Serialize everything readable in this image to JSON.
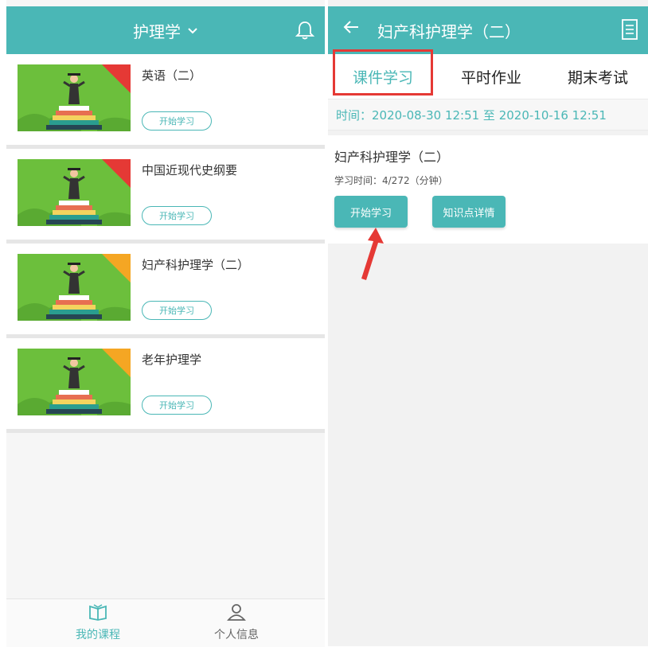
{
  "left": {
    "header_title": "护理学",
    "courses": [
      {
        "title": "英语（二）",
        "button": "开始学习",
        "ribbon_color": "#e53935"
      },
      {
        "title": "中国近现代史纲要",
        "button": "开始学习",
        "ribbon_color": "#e53935"
      },
      {
        "title": "妇产科护理学（二）",
        "button": "开始学习",
        "ribbon_color": "#f5a623"
      },
      {
        "title": "老年护理学",
        "button": "开始学习",
        "ribbon_color": "#f5a623"
      }
    ],
    "bottom_nav": [
      {
        "label": "我的课程",
        "active": true
      },
      {
        "label": "个人信息",
        "active": false
      }
    ]
  },
  "right": {
    "header_title": "妇产科护理学（二）",
    "tabs": [
      "课件学习",
      "平时作业",
      "期末考试"
    ],
    "active_tab": 0,
    "time_text": "时间：2020-08-30 12:51 至 2020-10-16 12:51",
    "course_title": "妇产科护理学（二）",
    "study_time": "学习时间：4/272（分钟）",
    "buttons": {
      "start": "开始学习",
      "knowledge": "知识点详情"
    }
  },
  "colors": {
    "accent": "#4ab7b6",
    "highlight": "#e53935"
  },
  "icons": [
    "chevron-down-icon",
    "bell-icon",
    "back-arrow-icon",
    "document-icon",
    "book-icon",
    "user-icon",
    "red-arrow-annotation"
  ]
}
